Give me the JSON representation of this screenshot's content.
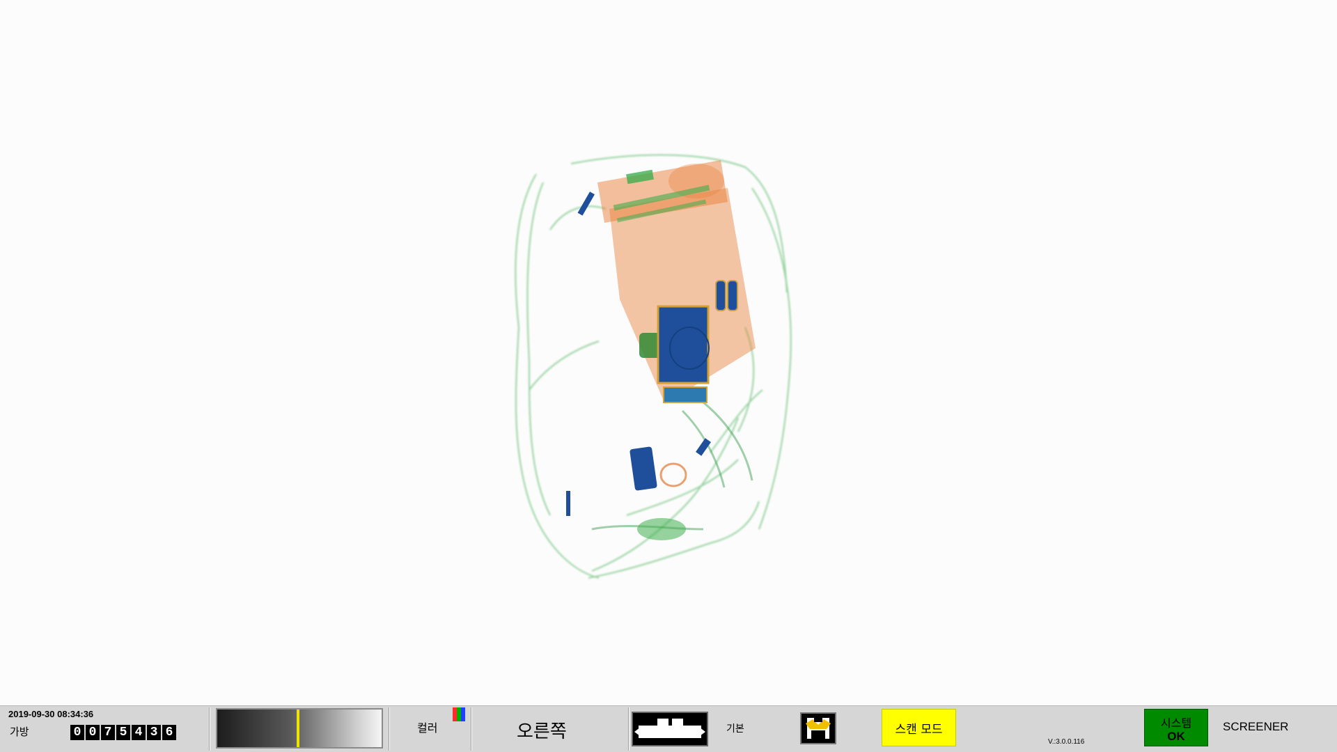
{
  "scan_view": {
    "description_icon": "xray-bag-image",
    "colors": {
      "organic": "#e8803a",
      "mixed": "#3fae4f",
      "metal": "#1f4f9a",
      "background": "#fcfcfc"
    }
  },
  "status_bar": {
    "datetime": "2019-09-30 08:34:36",
    "bag_label": "가방",
    "bag_counter_digits": [
      "0",
      "0",
      "7",
      "5",
      "4",
      "3",
      "6"
    ],
    "grayscale_level": 0.49,
    "color_label": "컬러",
    "color_icon_colors": [
      "#ff2a2a",
      "#00b000",
      "#2040ff"
    ],
    "direction_label": "오른쪽",
    "belt_icon": "conveyor-belt-icon",
    "mode_label": "기본",
    "save_icon": "save-image-icon",
    "scan_mode_button": "스캔 모드",
    "version": "V.:3.0.0.116",
    "system_status_line1": "시스템",
    "system_status_line2": "OK",
    "user_role": "SCREENER",
    "accent_colors": {
      "scan_mode": "#ffff00",
      "system_ok": "#008a00",
      "marker": "#f2e200"
    }
  }
}
